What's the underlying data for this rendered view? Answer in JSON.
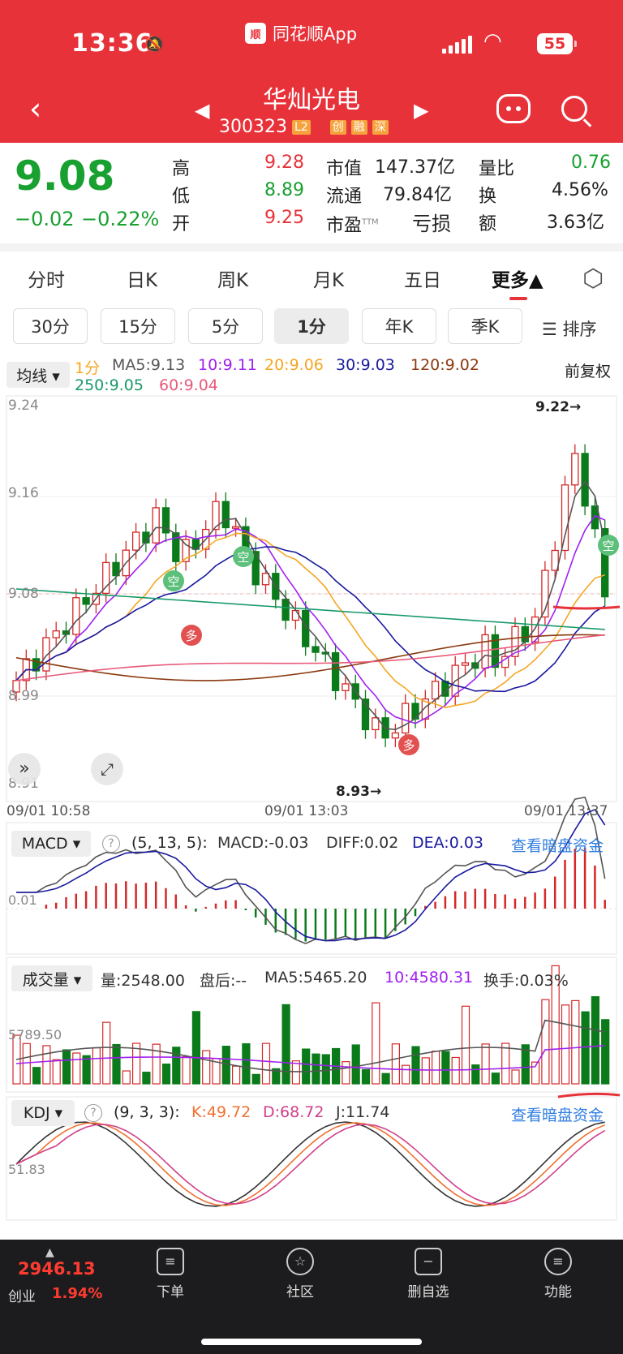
{
  "status": {
    "time": "13:36",
    "app": "同花顺App",
    "battery": "55"
  },
  "header": {
    "title": "华灿光电",
    "code": "300323",
    "tags": [
      "L2",
      "创",
      "融",
      "深"
    ]
  },
  "quote": {
    "price": "9.08",
    "change": "−0.02",
    "change_pct": "−0.22%",
    "high_label": "高",
    "high": "9.28",
    "low_label": "低",
    "low": "8.89",
    "open_label": "开",
    "open": "9.25",
    "mktcap_label": "市值",
    "mktcap": "147.37亿",
    "float_label": "流通",
    "float": "79.84亿",
    "pe_label": "市盈",
    "pe_sup": "TTM",
    "pe": "亏损",
    "volratio_label": "量比",
    "volratio": "0.76",
    "turnover_label": "换",
    "turnover": "4.56%",
    "amount_label": "额",
    "amount": "3.63亿"
  },
  "tabs": [
    "分时",
    "日K",
    "周K",
    "月K",
    "五日",
    "更多▲"
  ],
  "subtabs": [
    "30分",
    "15分",
    "5分",
    "1分",
    "年K",
    "季K"
  ],
  "sort_label": "☰ 排序",
  "ma": {
    "dropdown": "均线 ▾",
    "period": "1分",
    "ma5": "MA5:9.13",
    "ma10": "10:9.11",
    "ma20": "20:9.06",
    "ma30": "30:9.03",
    "ma120": "120:9.02",
    "ma250": "250:9.05",
    "ma60": "60:9.04",
    "fq": "前复权",
    "colors": {
      "ma5": "#555555",
      "ma10": "#a020f0",
      "ma20": "#f5a623",
      "ma30": "#1a1aa0",
      "ma120": "#8b3a10",
      "ma250": "#1a9a6a",
      "ma60": "#e85a7a"
    }
  },
  "kline": {
    "yticks": [
      "9.24",
      "9.16",
      "9.08",
      "8.99",
      "8.91"
    ],
    "xticks": [
      "09/01 10:58",
      "09/01 13:03",
      "09/01 13:37"
    ],
    "high_mark": "9.22→",
    "low_mark": "8.93→",
    "badge_kong": "空",
    "badge_duo": "多"
  },
  "macd": {
    "dropdown": "MACD ▾",
    "params": "(5, 13, 5):",
    "macd": "MACD:-0.03",
    "diff": "DIFF:0.02",
    "dea": "DEA:0.03",
    "link": "查看暗盘资金",
    "ytick": "0.01"
  },
  "volume": {
    "dropdown": "成交量 ▾",
    "vol": "量:2548.00",
    "after": "盘后:--",
    "ma5": "MA5:5465.20",
    "ma10": "10:4580.31",
    "turn": "换手:0.03%",
    "ytick": "5789.50"
  },
  "kdj": {
    "dropdown": "KDJ ▾",
    "params": "(9, 3, 3):",
    "k": "K:49.72",
    "d": "D:68.72",
    "j": "J:11.74",
    "link": "查看暗盘资金",
    "ytick": "51.83"
  },
  "bottom": {
    "index_value": "2946.13",
    "index_name": "创业",
    "index_pct": "1.94%",
    "nav": [
      "下单",
      "社区",
      "删自选",
      "功能"
    ]
  }
}
